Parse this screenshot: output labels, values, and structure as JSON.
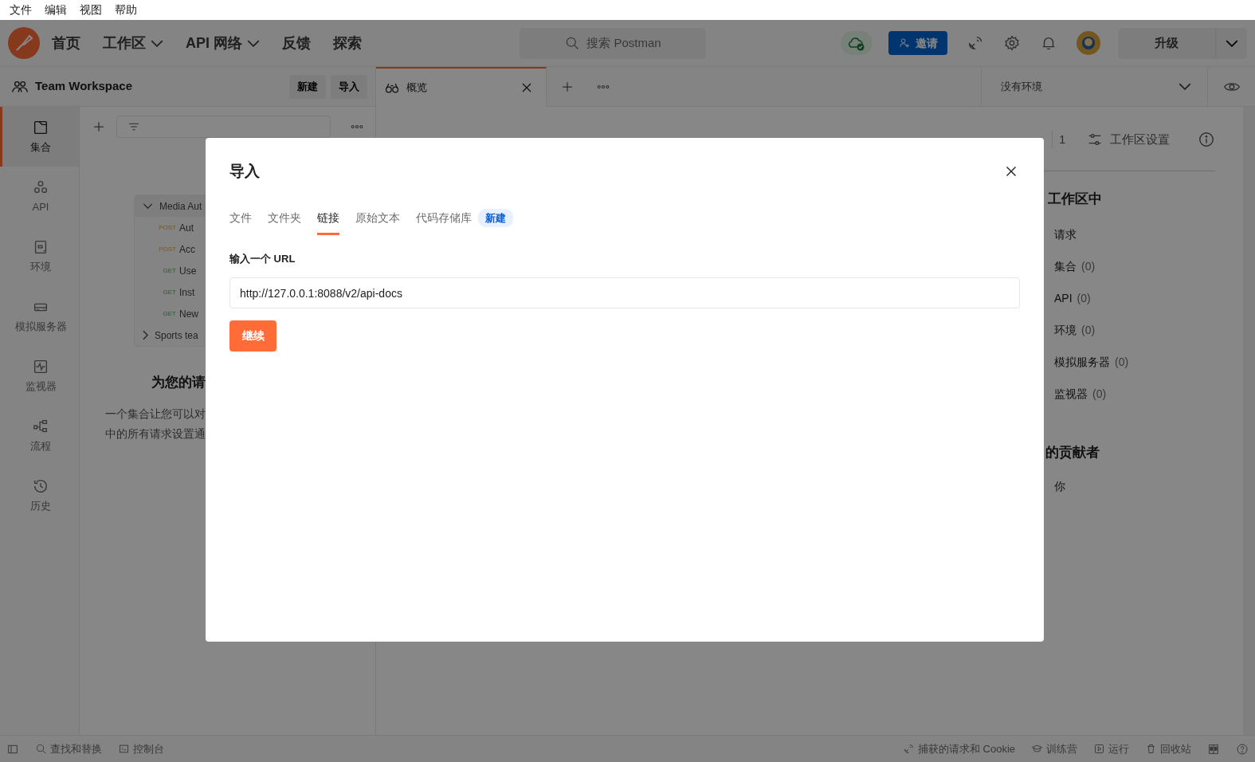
{
  "menu_bar": [
    "文件",
    "编辑",
    "视图",
    "帮助"
  ],
  "header": {
    "nav": [
      {
        "label": "首页",
        "dropdown": false
      },
      {
        "label": "工作区",
        "dropdown": true
      },
      {
        "label": "API 网络",
        "dropdown": true
      },
      {
        "label": "反馈",
        "dropdown": false
      },
      {
        "label": "探索",
        "dropdown": false
      }
    ],
    "search": {
      "placeholder": "搜索 Postman"
    },
    "invite_button": "邀请",
    "upgrade_button": "升级"
  },
  "workspace": {
    "name": "Team Workspace",
    "buttons": [
      "新建",
      "导入"
    ]
  },
  "tabs": [
    {
      "label": "概览",
      "selected": true
    }
  ],
  "environment": {
    "label": "没有环境"
  },
  "sidebar": [
    {
      "label": "集合",
      "selected": true
    },
    {
      "label": "API",
      "selected": false
    },
    {
      "label": "环境",
      "selected": false
    },
    {
      "label": "模拟服务器",
      "selected": false
    },
    {
      "label": "监视器",
      "selected": false
    },
    {
      "label": "流程",
      "selected": false
    },
    {
      "label": "历史",
      "selected": false
    }
  ],
  "collections": [
    {
      "name": "Media Aut",
      "expanded": true,
      "children": [
        {
          "kind": "post",
          "method": "POST",
          "name": "Aut"
        },
        {
          "kind": "post",
          "method": "POST",
          "name": "Acc"
        },
        {
          "kind": "get",
          "method": "GET",
          "name": "Use"
        },
        {
          "kind": "get",
          "method": "GET",
          "name": "Inst"
        },
        {
          "kind": "get",
          "method": "GET",
          "name": "New"
        }
      ]
    },
    {
      "name": "Sports tea",
      "expanded": false
    }
  ],
  "empty_state": {
    "title": "为您的请",
    "lines": [
      "一个集合让您可以对",
      "中的所有请求设置通"
    ]
  },
  "overview": {
    "watch_count": "1",
    "settings": "工作区设置",
    "section_title": "工作区中",
    "items": [
      {
        "label": "请求"
      },
      {
        "label": "集合",
        "count": "(0)"
      },
      {
        "label": "API",
        "count": "(0)"
      },
      {
        "label": "环境",
        "count": "(0)"
      },
      {
        "label": "模拟服务器",
        "count": "(0)"
      },
      {
        "label": "监视器",
        "count": "(0)"
      }
    ],
    "contributors_title": "的贡献者",
    "contributors": [
      "你"
    ]
  },
  "status_bar": {
    "left": [
      "查找和替换",
      "控制台"
    ],
    "right": [
      "捕获的请求和 Cookie",
      "训练营",
      "运行",
      "回收站"
    ]
  },
  "modal": {
    "title": "导入",
    "tabs": [
      {
        "label": "文件",
        "selected": false
      },
      {
        "label": "文件夹",
        "selected": false
      },
      {
        "label": "链接",
        "selected": true
      },
      {
        "label": "原始文本",
        "selected": false
      },
      {
        "label": "代码存储库",
        "selected": false,
        "badge": "新建"
      }
    ],
    "url_label": "输入一个 URL",
    "url_value": "http://127.0.0.1:8088/v2/api-docs",
    "continue_button": "继续"
  }
}
